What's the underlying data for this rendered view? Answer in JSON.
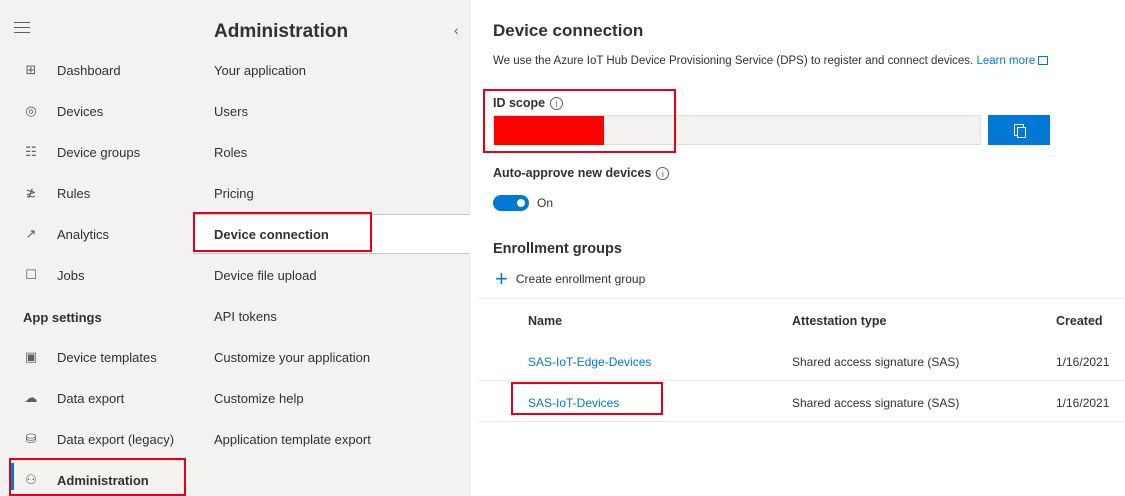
{
  "left_nav": {
    "menu_icon": "hamburger-icon",
    "items": [
      {
        "label": "Dashboard",
        "icon": "dashboard-icon"
      },
      {
        "label": "Devices",
        "icon": "devices-icon"
      },
      {
        "label": "Device groups",
        "icon": "device-groups-icon"
      },
      {
        "label": "Rules",
        "icon": "rules-icon"
      },
      {
        "label": "Analytics",
        "icon": "analytics-icon"
      },
      {
        "label": "Jobs",
        "icon": "jobs-icon"
      }
    ],
    "app_settings_heading": "App settings",
    "settings_items": [
      {
        "label": "Device templates",
        "icon": "device-templates-icon"
      },
      {
        "label": "Data export",
        "icon": "data-export-icon"
      },
      {
        "label": "Data export (legacy)",
        "icon": "data-export-legacy-icon"
      },
      {
        "label": "Administration",
        "icon": "administration-icon"
      }
    ]
  },
  "admin_panel": {
    "title": "Administration",
    "items": [
      "Your application",
      "Users",
      "Roles",
      "Pricing",
      "Device connection",
      "Device file upload",
      "API tokens",
      "Customize your application",
      "Customize help",
      "Application template export"
    ],
    "selected": "Device connection"
  },
  "main": {
    "title": "Device connection",
    "description": "We use the Azure IoT Hub Device Provisioning Service (DPS) to register and connect devices.",
    "learn_more": "Learn more",
    "id_scope_label": "ID scope",
    "id_scope_value": "",
    "auto_approve_label": "Auto-approve new devices",
    "toggle_state": "On",
    "enrollment_title": "Enrollment groups",
    "create_button": "Create enrollment group",
    "table": {
      "headers": [
        "Name",
        "Attestation type",
        "Created"
      ],
      "rows": [
        {
          "name": "SAS-IoT-Edge-Devices",
          "type": "Shared access signature (SAS)",
          "created": "1/16/2021"
        },
        {
          "name": "SAS-IoT-Devices",
          "type": "Shared access signature (SAS)",
          "created": "1/16/2021"
        }
      ]
    }
  },
  "colors": {
    "accent": "#0078d4",
    "highlight": "#e3001b",
    "redaction": "#ff0000",
    "nav_bg": "#f3f2f1"
  }
}
